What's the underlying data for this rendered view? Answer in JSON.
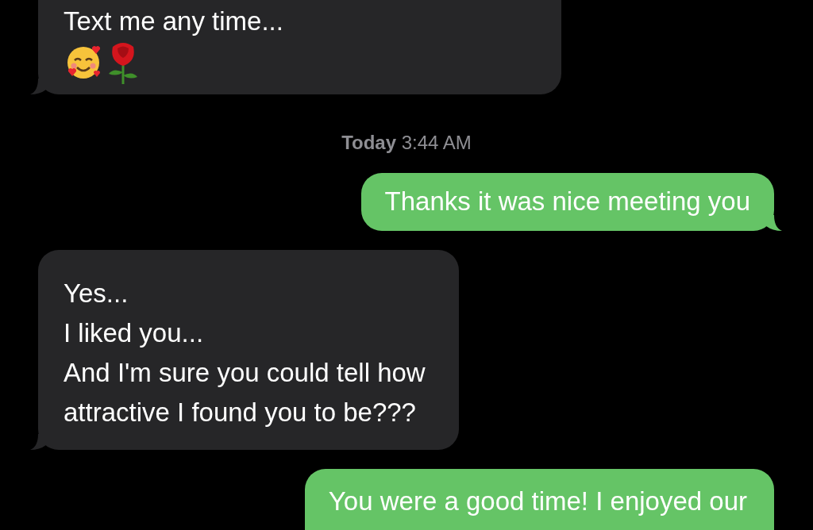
{
  "messages": [
    {
      "kind": "received",
      "lines": [
        "Text me any time..."
      ],
      "emoji_line": true
    },
    {
      "kind": "timestamp",
      "day": "Today",
      "time": "3:44 AM"
    },
    {
      "kind": "sent",
      "lines": [
        "Thanks it was nice meeting you"
      ]
    },
    {
      "kind": "received",
      "lines": [
        "Yes...",
        "I liked you...",
        "And I'm sure you could tell how",
        "attractive I found you to be???"
      ]
    },
    {
      "kind": "sent",
      "lines": [
        "You were a good time! I enjoyed our"
      ]
    }
  ]
}
